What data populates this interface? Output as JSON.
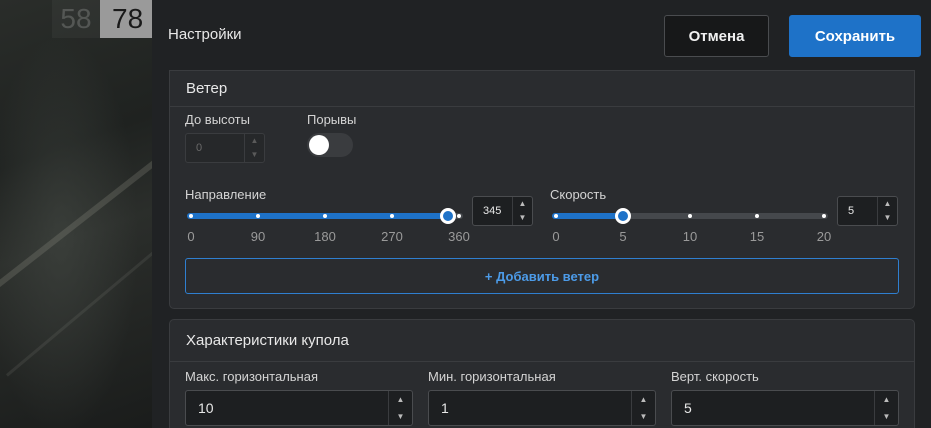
{
  "background": {
    "tile_a": "58",
    "tile_b": "78"
  },
  "header": {
    "title": "Настройки",
    "cancel_label": "Отмена",
    "save_label": "Сохранить"
  },
  "wind": {
    "title": "Ветер",
    "altitude": {
      "label": "До высоты",
      "value": "0",
      "disabled": true
    },
    "gusts": {
      "label": "Порывы",
      "on": false
    },
    "direction": {
      "label": "Направление",
      "value": "345",
      "min": 0,
      "max": 360,
      "ticks": [
        "0",
        "90",
        "180",
        "270",
        "360"
      ]
    },
    "speed": {
      "label": "Скорость",
      "value": "5",
      "min": 0,
      "max": 20,
      "ticks": [
        "0",
        "5",
        "10",
        "15",
        "20"
      ]
    },
    "add_label": "+ Добавить ветер"
  },
  "dome": {
    "title": "Характеристики купола",
    "max_horizontal": {
      "label": "Макс. горизонтальная",
      "value": "10"
    },
    "min_horizontal": {
      "label": "Мин. горизонтальная",
      "value": "1"
    },
    "vertical_speed": {
      "label": "Верт. скорость",
      "value": "5"
    }
  },
  "colors": {
    "accent": "#1e72c8",
    "panel": "#202224",
    "card": "#2a2c2f"
  },
  "icons": {
    "spin_up": "chevron-up-icon",
    "spin_down": "chevron-down-icon"
  }
}
